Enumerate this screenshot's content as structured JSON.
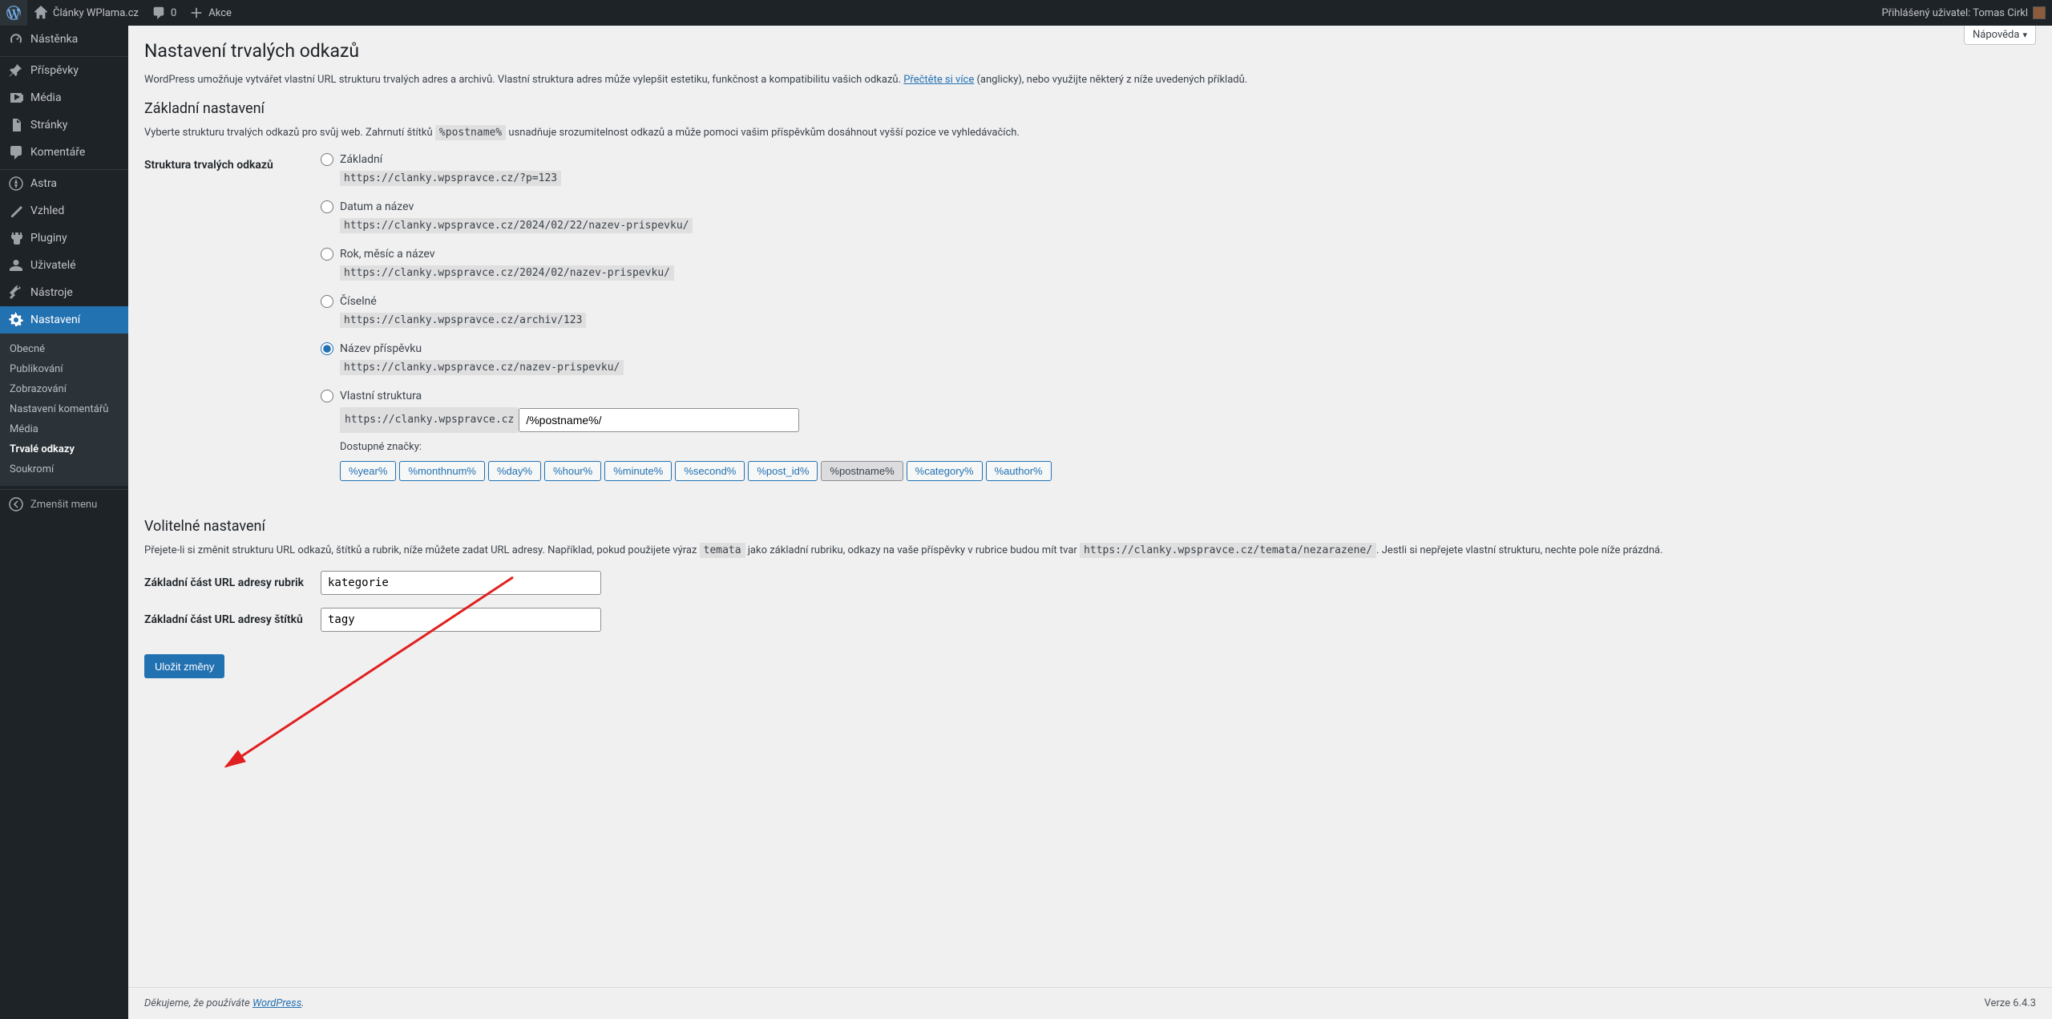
{
  "adminbar": {
    "site_name": "Články WPlama.cz",
    "comments_count": "0",
    "new_label": "Akce",
    "greeting": "Přihlášený uživatel: Tomas Cirkl"
  },
  "menu": {
    "dashboard": "Nástěnka",
    "posts": "Příspěvky",
    "media": "Média",
    "pages": "Stránky",
    "comments": "Komentáře",
    "astra": "Astra",
    "appearance": "Vzhled",
    "plugins": "Pluginy",
    "users": "Uživatelé",
    "tools": "Nástroje",
    "settings": "Nastavení",
    "collapse": "Zmenšit menu"
  },
  "submenu": {
    "general": "Obecné",
    "writing": "Publikování",
    "reading": "Zobrazování",
    "discussion": "Nastavení komentářů",
    "media": "Média",
    "permalinks": "Trvalé odkazy",
    "privacy": "Soukromí"
  },
  "help_tab": "Nápověda",
  "title": "Nastavení trvalých odkazů",
  "intro_text_1": "WordPress umožňuje vytvářet vlastní URL strukturu trvalých adres a archivů. Vlastní struktura adres může vylepšit estetiku, funkčnost a kompatibilitu vašich odkazů. ",
  "intro_link": "Přečtěte si více",
  "intro_text_2": " (anglicky), nebo využijte některý z níže uvedených příkladů.",
  "section_common": "Základní nastavení",
  "common_desc_1": "Vyberte strukturu trvalých odkazů pro svůj web. Zahrnutí štítků ",
  "common_desc_code": "%postname%",
  "common_desc_2": " usnadňuje srozumitelnost odkazů a může pomoci vašim příspěvkům dosáhnout vyšší pozice ve vyhledávačích.",
  "row_label": "Struktura trvalých odkazů",
  "options": {
    "plain": {
      "label": "Základní",
      "url": "https://clanky.wpspravce.cz/?p=123"
    },
    "dayname": {
      "label": "Datum a název",
      "url": "https://clanky.wpspravce.cz/2024/02/22/nazev-prispevku/"
    },
    "monthname": {
      "label": "Rok, měsíc a název",
      "url": "https://clanky.wpspravce.cz/2024/02/nazev-prispevku/"
    },
    "numeric": {
      "label": "Číselné",
      "url": "https://clanky.wpspravce.cz/archiv/123"
    },
    "postname": {
      "label": "Název příspěvku",
      "url": "https://clanky.wpspravce.cz/nazev-prispevku/"
    },
    "custom": {
      "label": "Vlastní struktura",
      "prefix": "https://clanky.wpspravce.cz",
      "value": "/%postname%/"
    }
  },
  "available_tags_label": "Dostupné značky:",
  "tags": [
    "%year%",
    "%monthnum%",
    "%day%",
    "%hour%",
    "%minute%",
    "%second%",
    "%post_id%",
    "%postname%",
    "%category%",
    "%author%"
  ],
  "active_tag": "%postname%",
  "section_optional": "Volitelné nastavení",
  "optional_desc_1": "Přejete-li si změnit strukturu URL odkazů, štítků a rubrik, níže můžete zadat URL adresy. Například, pokud použijete výraz ",
  "optional_desc_code1": "temata",
  "optional_desc_2": " jako základní rubriku, odkazy na vaše příspěvky v rubrice budou mít tvar ",
  "optional_desc_code2": "https://clanky.wpspravce.cz/temata/nezarazene/",
  "optional_desc_3": ". Jestli si nepřejete vlastní strukturu, nechte pole níže prázdná.",
  "category_base_label": "Základní část URL adresy rubrik",
  "category_base_value": "kategorie",
  "tag_base_label": "Základní část URL adresy štítků",
  "tag_base_value": "tagy",
  "submit_label": "Uložit změny",
  "footer_text": "Děkujeme, že používáte ",
  "footer_link": "WordPress",
  "footer_version": "Verze 6.4.3"
}
